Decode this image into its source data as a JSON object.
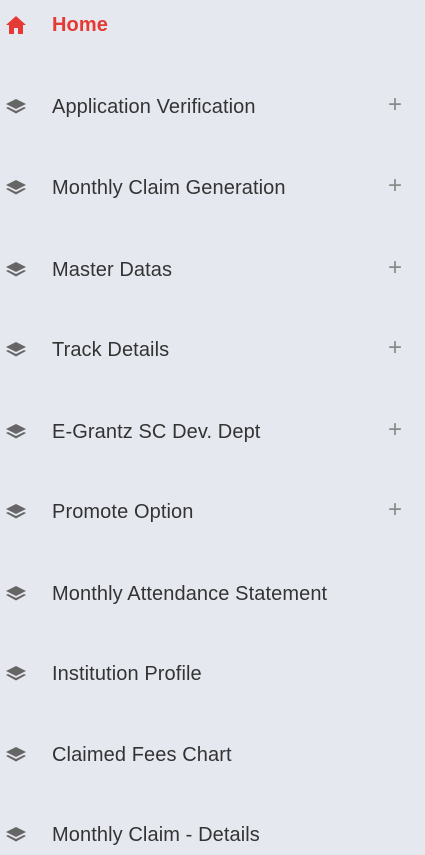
{
  "menu": {
    "items": [
      {
        "label": "Home",
        "icon": "home-icon",
        "active": true,
        "expandable": false
      },
      {
        "label": "Application Verification",
        "icon": "layers-icon",
        "active": false,
        "expandable": true
      },
      {
        "label": "Monthly Claim Generation",
        "icon": "layers-icon",
        "active": false,
        "expandable": true
      },
      {
        "label": "Master Datas",
        "icon": "layers-icon",
        "active": false,
        "expandable": true
      },
      {
        "label": "Track Details",
        "icon": "layers-icon",
        "active": false,
        "expandable": true
      },
      {
        "label": "E-Grantz SC Dev. Dept",
        "icon": "layers-icon",
        "active": false,
        "expandable": true
      },
      {
        "label": "Promote Option",
        "icon": "layers-icon",
        "active": false,
        "expandable": true
      },
      {
        "label": "Monthly Attendance Statement",
        "icon": "layers-icon",
        "active": false,
        "expandable": false
      },
      {
        "label": "Institution Profile",
        "icon": "layers-icon",
        "active": false,
        "expandable": false
      },
      {
        "label": "Claimed Fees Chart",
        "icon": "layers-icon",
        "active": false,
        "expandable": false
      },
      {
        "label": "Monthly Claim - Details",
        "icon": "layers-icon",
        "active": false,
        "expandable": false
      }
    ],
    "expand_symbol": "+"
  },
  "colors": {
    "background": "#e6e8f0",
    "active": "#e53935",
    "text": "#333333",
    "icon": "#666666",
    "expand": "#8a8a8a"
  }
}
